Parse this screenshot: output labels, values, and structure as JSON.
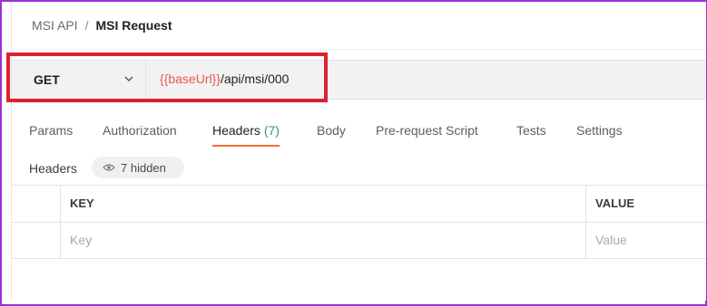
{
  "breadcrumb": {
    "parent": "MSI API",
    "separator": "/",
    "current": "MSI Request"
  },
  "request": {
    "method": "GET",
    "url_variable": "{{baseUrl}}",
    "url_path": "/api/msi/000"
  },
  "tabs": [
    {
      "label": "Params"
    },
    {
      "label": "Authorization"
    },
    {
      "label": "Headers",
      "count": "(7)",
      "active": true
    },
    {
      "label": "Body"
    },
    {
      "label": "Pre-request Script"
    },
    {
      "label": "Tests"
    },
    {
      "label": "Settings"
    }
  ],
  "headers_section": {
    "title": "Headers",
    "hidden_label": "7 hidden"
  },
  "table": {
    "columns": {
      "key": "KEY",
      "value": "VALUE"
    },
    "placeholders": {
      "key": "Key",
      "value": "Value"
    }
  },
  "colors": {
    "accent": "#f26b3a",
    "highlight_box": "#e0202f",
    "frame": "#9b30d9",
    "variable": "#e8584a",
    "count": "#2c9a59"
  }
}
